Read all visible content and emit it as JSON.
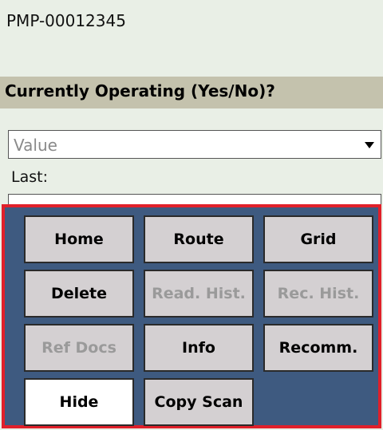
{
  "equipment": {
    "id": "PMP-00012345"
  },
  "question": {
    "text": "Currently Operating (Yes/No)?"
  },
  "value_field": {
    "placeholder": "Value",
    "dropdown_icon": "chevron-down-icon"
  },
  "last_field": {
    "label": "Last:",
    "value": ""
  },
  "buttons": {
    "home": "Home",
    "route": "Route",
    "grid": "Grid",
    "delete": "Delete",
    "read_hist": "Read. Hist.",
    "rec_hist": "Rec. Hist.",
    "ref_docs": "Ref Docs",
    "info": "Info",
    "recomm": "Recomm.",
    "hide": "Hide",
    "copy_scan": "Copy Scan"
  },
  "button_states": {
    "disabled": [
      "read_hist",
      "rec_hist",
      "ref_docs"
    ],
    "highlighted": [
      "hide"
    ]
  },
  "colors": {
    "panel_background": "#3e5a80",
    "panel_border": "#e0202a",
    "question_band": "#c4c2ad",
    "disabled_text": "#9a9a9a"
  }
}
